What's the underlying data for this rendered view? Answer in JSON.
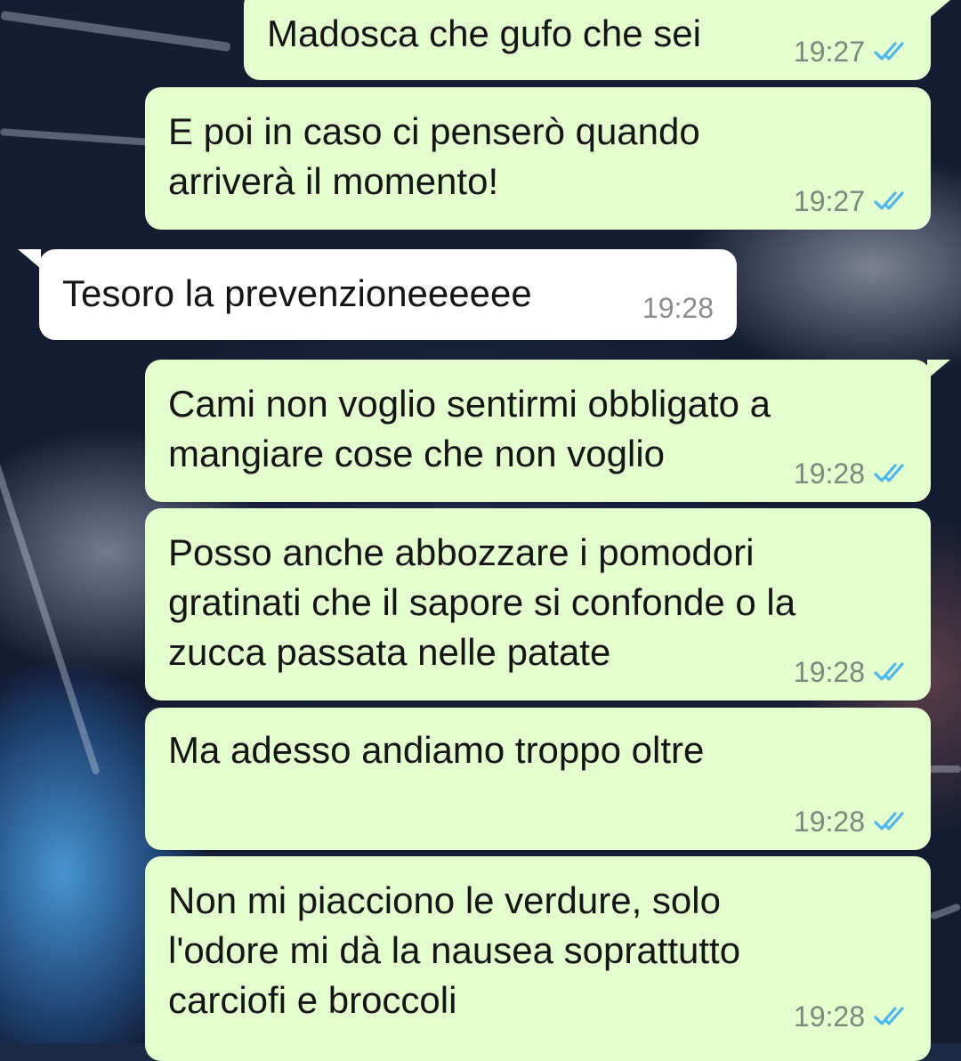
{
  "chat": {
    "messages": [
      {
        "direction": "outgoing",
        "text": "Madosca che gufo che sei",
        "time": "19:27",
        "status_icon": "double-check-read-icon"
      },
      {
        "direction": "outgoing",
        "text": "E poi in caso ci penserò quando\narriverà il momento!",
        "time": "19:27",
        "status_icon": "double-check-read-icon"
      },
      {
        "direction": "incoming",
        "text": "Tesoro la prevenzioneeeeee",
        "time": "19:28"
      },
      {
        "direction": "outgoing",
        "text": "Cami non voglio sentirmi obbligato a\nmangiare cose che non voglio",
        "time": "19:28",
        "status_icon": "double-check-read-icon"
      },
      {
        "direction": "outgoing",
        "text": "Posso anche abbozzare i pomodori\ngratinati che il sapore si confonde o la\nzucca passata nelle patate",
        "time": "19:28",
        "status_icon": "double-check-read-icon"
      },
      {
        "direction": "outgoing",
        "text": "Ma adesso andiamo troppo oltre",
        "time": "19:28",
        "status_icon": "double-check-read-icon"
      },
      {
        "direction": "outgoing",
        "text": "Non mi piacciono le verdure, solo\nl'odore mi dà la nausea soprattutto\ncarciofi e broccoli",
        "time": "19:28",
        "status_icon": "double-check-read-icon"
      }
    ]
  },
  "colors": {
    "outgoing_bubble": "#e3fdcf",
    "incoming_bubble": "#ffffff",
    "read_ticks": "#4fb6ec"
  }
}
